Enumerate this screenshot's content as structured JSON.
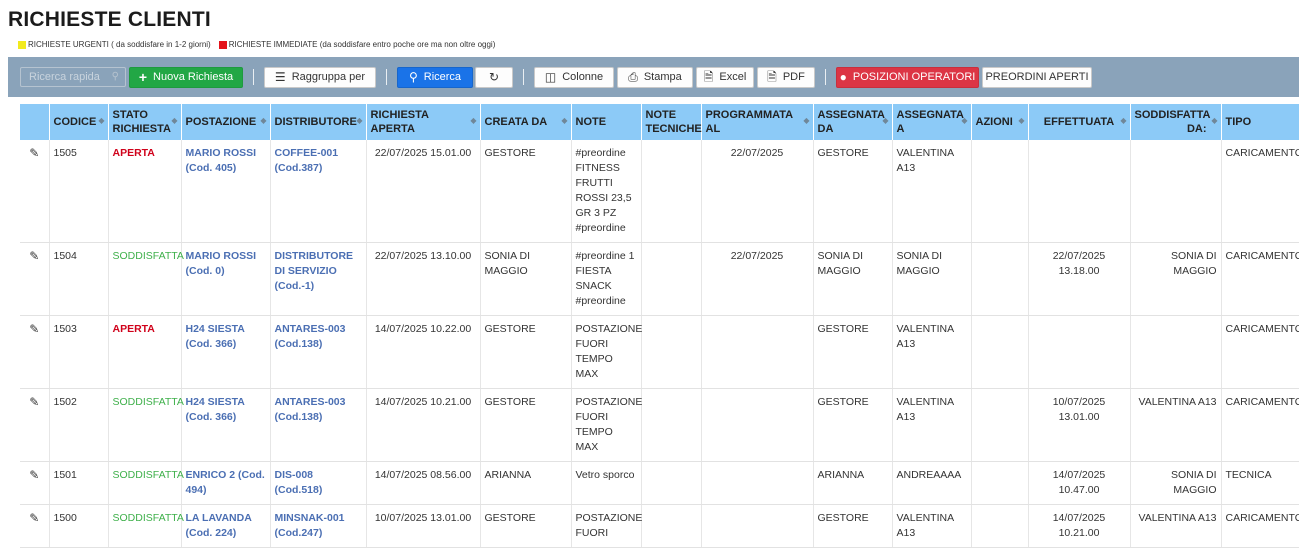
{
  "page_title": "RICHIESTE CLIENTI",
  "legend": {
    "urgent": {
      "label": "RICHIESTE URGENTI ( da soddisfare in 1-2 giorni)",
      "color": "#f2ea1d"
    },
    "immediate": {
      "label": "RICHIESTE IMMEDIATE (da soddisfare entro poche ore ma non oltre oggi)",
      "color": "#e4141b"
    }
  },
  "toolbar": {
    "search_placeholder": "Ricerca rapida",
    "new_request": "Nuova Richiesta",
    "group_by": "Raggruppa per",
    "search": "Ricerca",
    "columns": "Colonne",
    "print": "Stampa",
    "excel": "Excel",
    "pdf": "PDF",
    "operators": "POSIZIONI OPERATORI",
    "preorders": "PREORDINI APERTI"
  },
  "columns": {
    "codice": "CODICE",
    "stato": "STATO RICHIESTA",
    "postazione": "POSTAZIONE",
    "distributore": "DISTRIBUTORE",
    "aperta": "RICHIESTA APERTA",
    "creata": "CREATA DA",
    "note": "NOTE",
    "note_tecniche": "NOTE TECNICHE",
    "programmata": "PROGRAMMATA AL",
    "assegnata_da": "ASSEGNATA DA",
    "assegnata_a": "ASSEGNATA A",
    "azioni": "AZIONI",
    "effettuata": "EFFETTUATA",
    "soddisfatta": "SODDISFATTA DA:",
    "tipo": "TIPO"
  },
  "rows": [
    {
      "codice": "1505",
      "stato": "APERTA",
      "postazione": "MARIO ROSSI (Cod. 405)",
      "distributore": "COFFEE-001 (Cod.387)",
      "aperta": "22/07/2025 15.01.00",
      "creata": "GESTORE",
      "note": "#preordine FITNESS FRUTTI ROSSI 23,5 GR 3 PZ #preordine",
      "note_tecniche": "",
      "programmata": "22/07/2025",
      "assegnata_da": "GESTORE",
      "assegnata_a": "VALENTINA A13",
      "azioni": "",
      "effettuata": "",
      "soddisfatta": "",
      "tipo": "CARICAMENTO"
    },
    {
      "codice": "1504",
      "stato": "SODDISFATTA",
      "postazione": "MARIO ROSSI (Cod. 0)",
      "distributore": "DISTRIBUTORE DI SERVIZIO (Cod.-1)",
      "aperta": "22/07/2025 13.10.00",
      "creata": "SONIA DI MAGGIO",
      "note": "#preordine 1 FIESTA SNACK #preordine",
      "note_tecniche": "",
      "programmata": "22/07/2025",
      "assegnata_da": "SONIA DI MAGGIO",
      "assegnata_a": "SONIA DI MAGGIO",
      "azioni": "",
      "effettuata": "22/07/2025 13.18.00",
      "soddisfatta": "SONIA DI MAGGIO",
      "tipo": "CARICAMENTO"
    },
    {
      "codice": "1503",
      "stato": "APERTA",
      "postazione": "H24 SIESTA (Cod. 366)",
      "distributore": "ANTARES-003 (Cod.138)",
      "aperta": "14/07/2025 10.22.00",
      "creata": "GESTORE",
      "note": "POSTAZIONE FUORI TEMPO MAX",
      "note_tecniche": "",
      "programmata": "",
      "assegnata_da": "GESTORE",
      "assegnata_a": "VALENTINA A13",
      "azioni": "",
      "effettuata": "",
      "soddisfatta": "",
      "tipo": "CARICAMENTO"
    },
    {
      "codice": "1502",
      "stato": "SODDISFATTA",
      "postazione": "H24 SIESTA (Cod. 366)",
      "distributore": "ANTARES-003 (Cod.138)",
      "aperta": "14/07/2025 10.21.00",
      "creata": "GESTORE",
      "note": "POSTAZIONE FUORI TEMPO MAX",
      "note_tecniche": "",
      "programmata": "",
      "assegnata_da": "GESTORE",
      "assegnata_a": "VALENTINA A13",
      "azioni": "",
      "effettuata": "10/07/2025 13.01.00",
      "soddisfatta": "VALENTINA A13",
      "tipo": "CARICAMENTO"
    },
    {
      "codice": "1501",
      "stato": "SODDISFATTA",
      "postazione": "ENRICO 2 (Cod. 494)",
      "distributore": "DIS-008 (Cod.518)",
      "aperta": "14/07/2025 08.56.00",
      "creata": "ARIANNA",
      "note": "Vetro sporco",
      "note_tecniche": "",
      "programmata": "",
      "assegnata_da": "ARIANNA",
      "assegnata_a": "ANDREAAAA",
      "azioni": "",
      "effettuata": "14/07/2025 10.47.00",
      "soddisfatta": "SONIA DI MAGGIO",
      "tipo": "TECNICA"
    },
    {
      "codice": "1500",
      "stato": "SODDISFATTA",
      "postazione": "LA LAVANDA (Cod. 224)",
      "distributore": "MINSNAK-001 (Cod.247)",
      "aperta": "10/07/2025 13.01.00",
      "creata": "GESTORE",
      "note": "POSTAZIONE FUORI",
      "note_tecniche": "",
      "programmata": "",
      "assegnata_da": "GESTORE",
      "assegnata_a": "VALENTINA A13",
      "azioni": "",
      "effettuata": "14/07/2025 10.21.00",
      "soddisfatta": "VALENTINA A13",
      "tipo": "CARICAMENTO"
    }
  ]
}
